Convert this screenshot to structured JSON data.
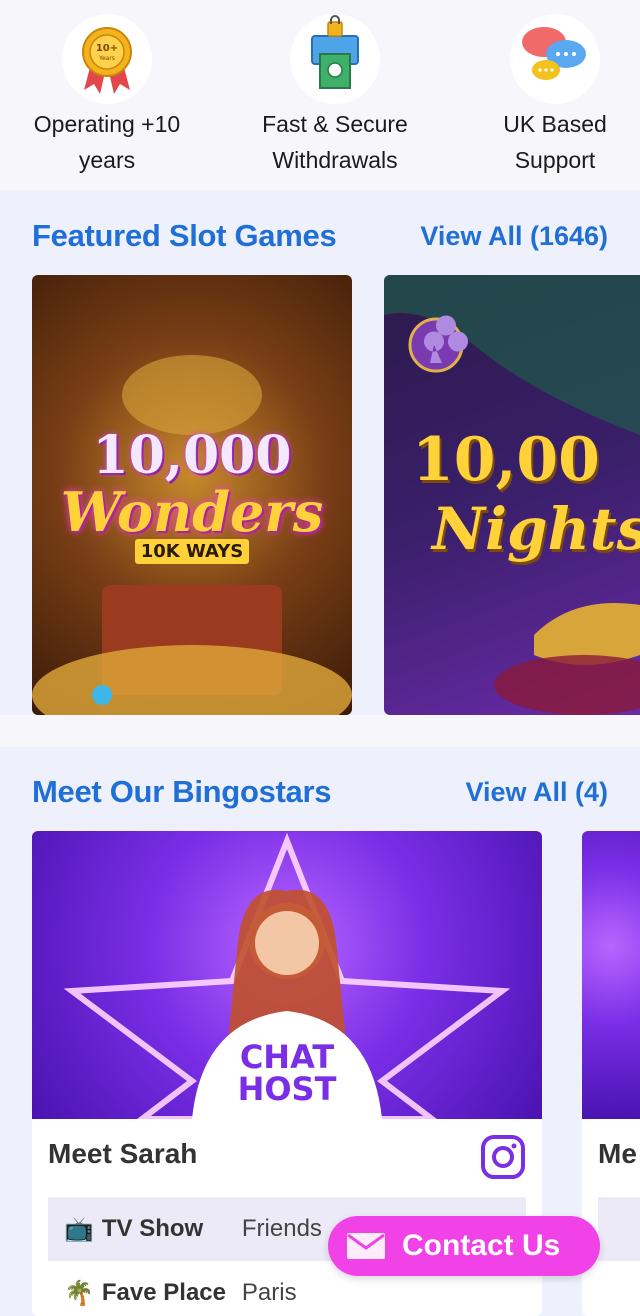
{
  "features": [
    {
      "icon": "ribbon-badge-icon",
      "badge": "10+",
      "badge_sub": "Years",
      "line1": "Operating +10",
      "line2": "years"
    },
    {
      "icon": "secure-withdrawal-icon",
      "line1": "Fast & Secure",
      "line2": "Withdrawals"
    },
    {
      "icon": "chat-bubbles-icon",
      "line1": "UK Based",
      "line2": "Support"
    }
  ],
  "slots": {
    "title": "Featured Slot Games",
    "view_all": "View All (1646)",
    "games": [
      {
        "line1": "10,000",
        "line2": "Wonders",
        "line3": "10K WAYS"
      },
      {
        "line1": "10,00",
        "line2": "Nights"
      }
    ]
  },
  "bingostars": {
    "title": "Meet Our Bingostars",
    "view_all": "View All (4)",
    "hosts": [
      {
        "name": "Meet Sarah",
        "shirt_line1": "CHAT",
        "shirt_line2": "HOST",
        "rows": [
          {
            "icon": "tv-icon",
            "label": "TV Show",
            "value": "Friends"
          },
          {
            "icon": "palm-tree-icon",
            "label": "Fave Place",
            "value": "Paris"
          }
        ]
      },
      {
        "name": "Me"
      }
    ]
  },
  "contact": {
    "label": "Contact Us",
    "icon": "envelope-icon"
  },
  "colors": {
    "accent": "#1f6fd6",
    "contact": "#f042e6",
    "host_bg": "#7a2ee6"
  }
}
